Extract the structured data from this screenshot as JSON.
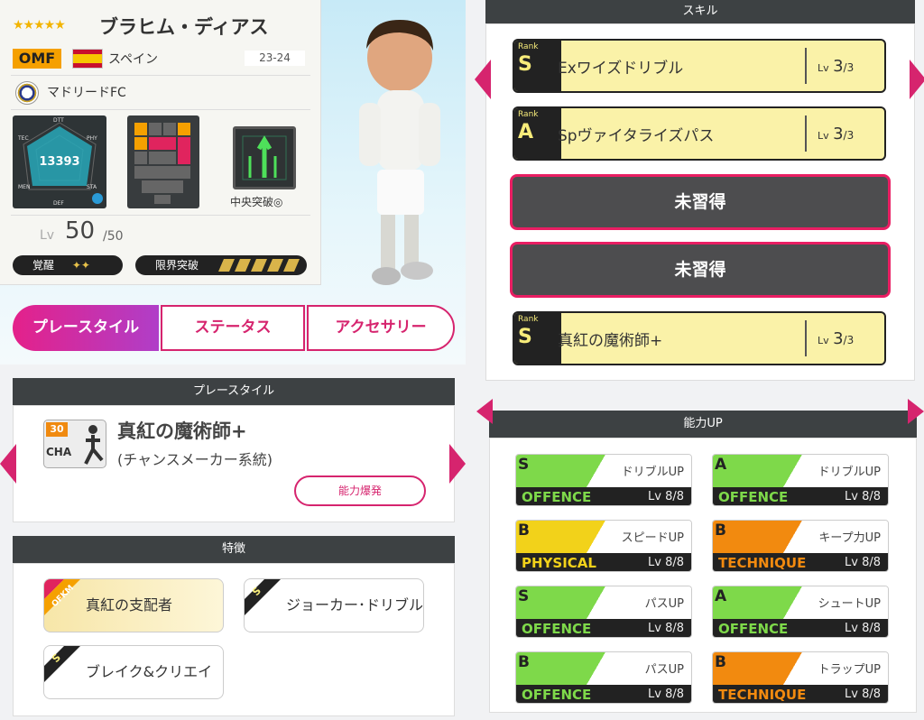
{
  "player": {
    "stars": "★★★★★",
    "name": "ブラヒム・ディアス",
    "position": "OMF",
    "country": "スペイン",
    "season": "23-24",
    "club": "マドリードFC",
    "radar_value": "13393",
    "radar_labels": {
      "top": "DTT",
      "tl": "TEC",
      "tr": "PHY",
      "bl": "MEN",
      "br": "STA",
      "bottom": "DEF"
    },
    "tactic_label": "中央突破◎",
    "level_label": "Lv",
    "level": "50",
    "level_max": "/50",
    "awaken_label": "覚醒",
    "awaken_icons": "✦✦",
    "limit_label": "限界突破"
  },
  "tabs": [
    "プレースタイル",
    "ステータス",
    "アクセサリー"
  ],
  "playstyle": {
    "header": "プレースタイル",
    "icon_num": "30",
    "icon_type": "CHA",
    "title": "真紅の魔術師+",
    "subtitle": "(チャンスメーカー系統)",
    "button": "能力爆発"
  },
  "traits": {
    "header": "特徴",
    "items": [
      {
        "corner": "OFKM",
        "label": "真紅の支配者"
      },
      {
        "corner": "S",
        "label": "ジョーカー･ドリブル超"
      },
      {
        "corner": "S",
        "label": "ブレイク&クリエイト"
      }
    ]
  },
  "skills": {
    "header": "スキル",
    "rank_label": "Rank",
    "items": [
      {
        "rank": "S",
        "name": "Exワイズドリブル",
        "lv_label": "Lv",
        "lv": "3",
        "lv_max": "/3"
      },
      {
        "rank": "A",
        "name": "Spヴァイタライズパス",
        "lv_label": "Lv",
        "lv": "3",
        "lv_max": "/3"
      },
      {
        "rank": "S",
        "name": "真紅の魔術師+",
        "lv_label": "Lv",
        "lv": "3",
        "lv_max": "/3"
      }
    ],
    "locked": [
      "未習得",
      "未習得"
    ]
  },
  "ability": {
    "header": "能力UP",
    "items": [
      {
        "grade": "S",
        "name": "ドリブルUP",
        "category": "OFFENCE",
        "lv": "Lv 8/8",
        "color": "#7ed94a"
      },
      {
        "grade": "A",
        "name": "ドリブルUP",
        "category": "OFFENCE",
        "lv": "Lv 8/8",
        "color": "#7ed94a"
      },
      {
        "grade": "B",
        "name": "スピードUP",
        "category": "PHYSICAL",
        "lv": "Lv 8/8",
        "color": "#f2d21a"
      },
      {
        "grade": "B",
        "name": "キープ力UP",
        "category": "TECHNIQUE",
        "lv": "Lv 8/8",
        "color": "#f28a0f"
      },
      {
        "grade": "S",
        "name": "パスUP",
        "category": "OFFENCE",
        "lv": "Lv 8/8",
        "color": "#7ed94a"
      },
      {
        "grade": "A",
        "name": "シュートUP",
        "category": "OFFENCE",
        "lv": "Lv 8/8",
        "color": "#7ed94a"
      },
      {
        "grade": "B",
        "name": "パスUP",
        "category": "OFFENCE",
        "lv": "Lv 8/8",
        "color": "#7ed94a"
      },
      {
        "grade": "B",
        "name": "トラップUP",
        "category": "TECHNIQUE",
        "lv": "Lv 8/8",
        "color": "#f28a0f"
      }
    ]
  },
  "colors": {
    "accent": "#d6246e",
    "panel_dark": "#3d4143",
    "skill_bg": "#faf2a8"
  }
}
